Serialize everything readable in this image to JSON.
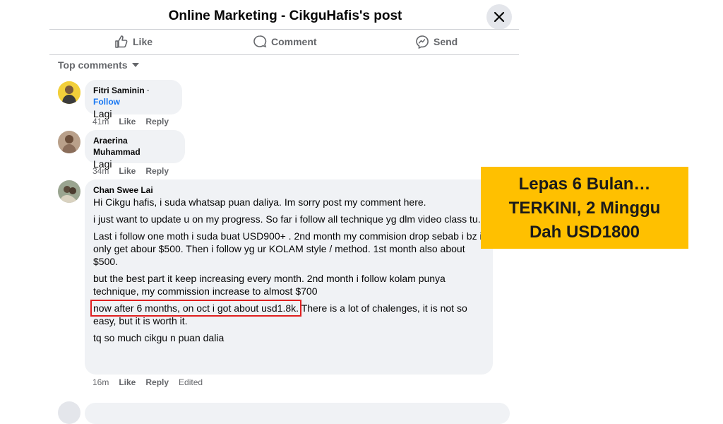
{
  "header": {
    "title": "Online Marketing - CikguHafis's post"
  },
  "actions": {
    "like": "Like",
    "comment": "Comment",
    "send": "Send"
  },
  "sort": {
    "label": "Top comments"
  },
  "comments": [
    {
      "author": "Fitri Saminin",
      "follow": "Follow",
      "lines": [
        "Lagi"
      ],
      "time": "41m",
      "like": "Like",
      "reply": "Reply"
    },
    {
      "author": "Araerina Muhammad",
      "lines": [
        "Lagi"
      ],
      "time": "34m",
      "like": "Like",
      "reply": "Reply"
    },
    {
      "author": "Chan Swee Lai",
      "lines": [
        "Hi Cikgu hafis, i suda whatsap puan daliya. Im sorry post my comment here.",
        "i just want to update u on my progress. So far i follow all technique yg dlm video class tu.",
        "Last i follow one moth i suda buat USD900+ . 2nd month my commision drop sebab i bz i only get abour $500. Then i follow yg ur KOLAM style / method. 1st month also about $500.",
        "but the best part it keep increasing every month. 2nd month i follow kolam punya technique, my commission increase to almost $700",
        "now after 6 months, on oct i got about usd1.8k.",
        " There is a lot of chalenges, it is not so easy, but it is worth it.",
        "tq so much cikgu n puan dalia"
      ],
      "time": "16m",
      "like": "Like",
      "reply": "Reply",
      "edited": "Edited"
    }
  ],
  "promo": {
    "line1": "Lepas 6 Bulan…",
    "line2": "TERKINI, 2 Minggu",
    "line3": "Dah USD1800"
  },
  "colors": {
    "bubble": "#f0f2f5",
    "promo": "#ffc000",
    "highlight": "#e02020",
    "link": "#1877f2"
  }
}
